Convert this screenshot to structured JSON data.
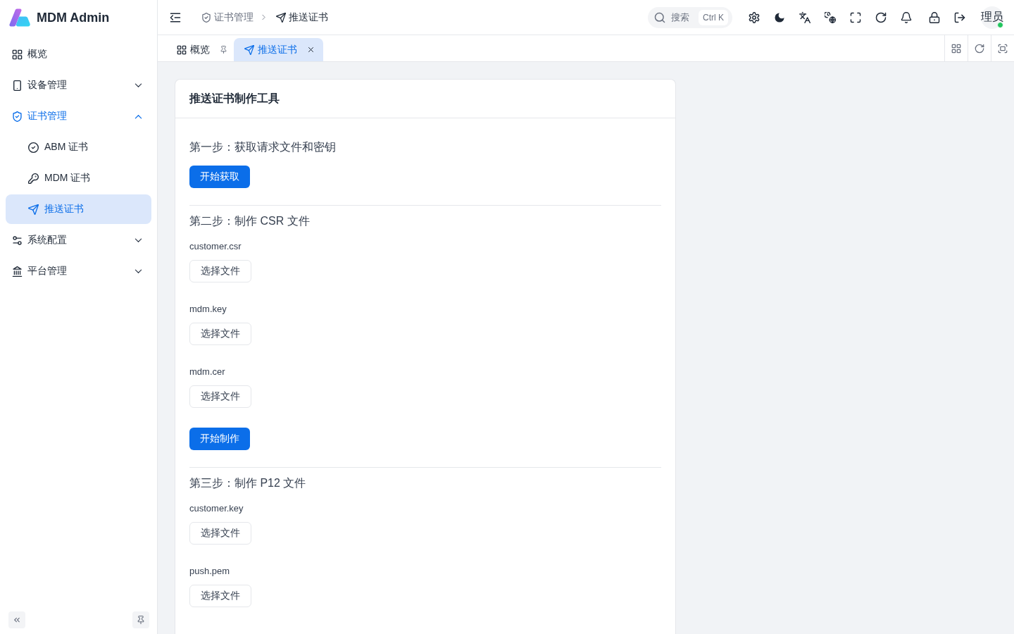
{
  "sidebar": {
    "app_name": "MDM Admin",
    "items": [
      {
        "kind": "link",
        "label": "概览",
        "selected": false
      },
      {
        "kind": "group",
        "label": "设备管理",
        "selected": false,
        "expanded": false
      },
      {
        "kind": "group",
        "label": "证书管理",
        "selected": false,
        "expanded": true,
        "children": [
          {
            "label": "ABM 证书",
            "selected": false
          },
          {
            "label": "MDM 证书",
            "selected": false
          },
          {
            "label": "推送证书",
            "selected": true
          }
        ]
      },
      {
        "kind": "group",
        "label": "系统配置",
        "selected": false,
        "expanded": false
      },
      {
        "kind": "group",
        "label": "平台管理",
        "selected": false,
        "expanded": false
      }
    ]
  },
  "header": {
    "breadcrumb": [
      {
        "label": "证书管理"
      },
      {
        "label": "推送证书"
      }
    ],
    "search": {
      "label": "搜索",
      "shortcut": "Ctrl K"
    },
    "user": {
      "avatar_text": "理员",
      "online": true
    }
  },
  "tabs": [
    {
      "label": "概览",
      "selected": false,
      "pinned": true,
      "closable": false
    },
    {
      "label": "推送证书",
      "selected": true,
      "pinned": false,
      "closable": true
    }
  ],
  "card": {
    "title": "推送证书制作工具",
    "sections": [
      {
        "title": "第一步：获取请求文件和密钥",
        "items": [
          {
            "kind": "action",
            "label": "开始获取"
          }
        ]
      },
      {
        "title": "第二步：制作 CSR 文件",
        "items": [
          {
            "kind": "file",
            "label": "customer.csr",
            "button": "选择文件"
          },
          {
            "kind": "file",
            "label": "mdm.key",
            "button": "选择文件"
          },
          {
            "kind": "file",
            "label": "mdm.cer",
            "button": "选择文件"
          },
          {
            "kind": "action",
            "label": "开始制作"
          }
        ]
      },
      {
        "title": "第三步：制作 P12 文件",
        "items": [
          {
            "kind": "file",
            "label": "customer.key",
            "button": "选择文件"
          },
          {
            "kind": "file",
            "label": "push.pem",
            "button": "选择文件"
          }
        ]
      }
    ]
  }
}
